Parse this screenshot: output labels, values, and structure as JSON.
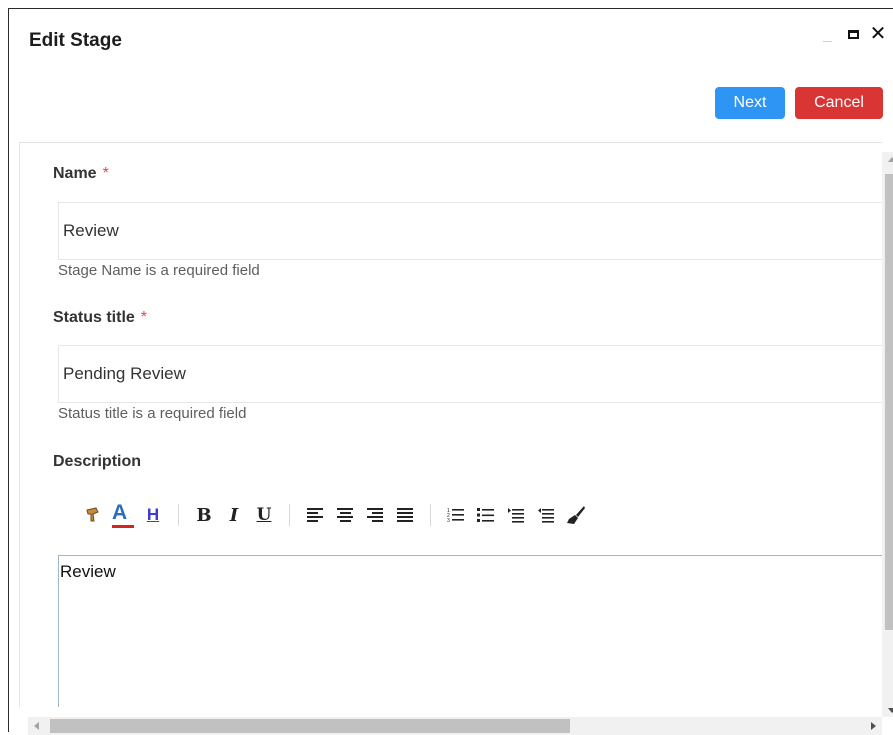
{
  "dialog": {
    "title": "Edit Stage",
    "controls": {
      "minimize_icon": "minimize-icon",
      "maximize_icon": "maximize-icon",
      "close_glyph": "✕"
    }
  },
  "actions": {
    "next_label": "Next",
    "cancel_label": "Cancel",
    "next_color": "#2e95f5",
    "cancel_color": "#d93535"
  },
  "form": {
    "name": {
      "label": "Name",
      "required_mark": "*",
      "value": "Review",
      "help": "Stage Name is a required field"
    },
    "status_title": {
      "label": "Status title",
      "required_mark": "*",
      "value": "Pending Review",
      "help": "Status title is a required field"
    },
    "description": {
      "label": "Description",
      "content": "Review",
      "toolbar": {
        "font_color_glyph": "A",
        "highlight_glyph": "H",
        "bold_glyph": "B",
        "italic_glyph": "I",
        "underline_glyph": "U"
      }
    }
  },
  "colors": {
    "required": "#e04848",
    "accent": "#2e95f5",
    "danger": "#d93535"
  }
}
